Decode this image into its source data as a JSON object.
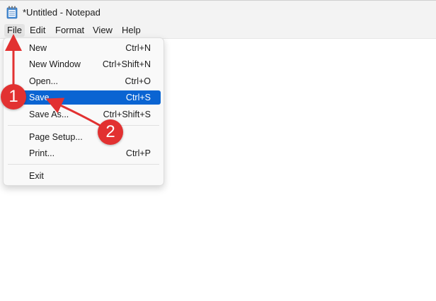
{
  "window": {
    "title": "*Untitled - Notepad",
    "icon": "notepad-icon"
  },
  "menubar": {
    "items": [
      "File",
      "Edit",
      "Format",
      "View",
      "Help"
    ],
    "active": "File"
  },
  "file_menu": {
    "items": [
      {
        "label": "New",
        "shortcut": "Ctrl+N"
      },
      {
        "label": "New Window",
        "shortcut": "Ctrl+Shift+N"
      },
      {
        "label": "Open...",
        "shortcut": "Ctrl+O"
      },
      {
        "label": "Save",
        "shortcut": "Ctrl+S",
        "highlighted": true
      },
      {
        "label": "Save As...",
        "shortcut": "Ctrl+Shift+S"
      },
      {
        "label": "Page Setup...",
        "shortcut": ""
      },
      {
        "label": "Print...",
        "shortcut": "Ctrl+P"
      },
      {
        "label": "Exit",
        "shortcut": ""
      }
    ]
  },
  "annotations": {
    "step1": "1",
    "step2": "2",
    "color": "#e23131"
  },
  "colors": {
    "highlight": "#0a64d2",
    "titlebar": "#f3f3f3"
  }
}
